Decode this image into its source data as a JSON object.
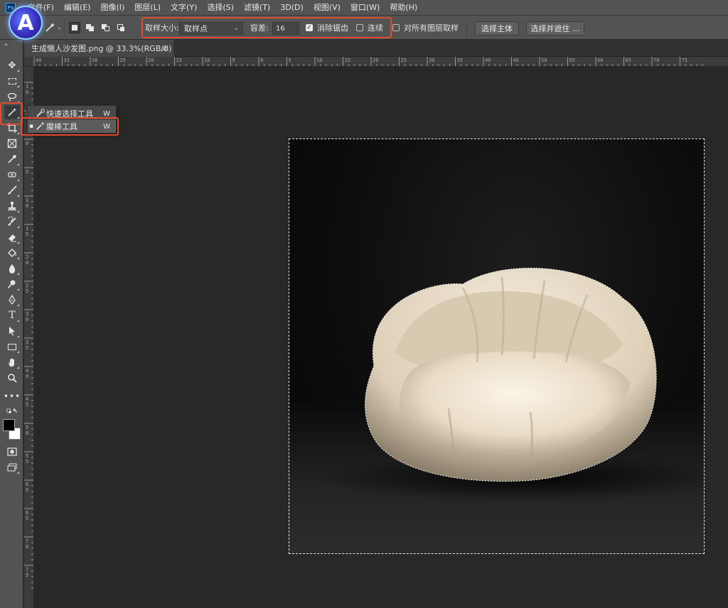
{
  "app": {
    "logo_text": "Ps"
  },
  "badge": {
    "letter": "A"
  },
  "menu": [
    "文件(F)",
    "编辑(E)",
    "图像(I)",
    "图层(L)",
    "文字(Y)",
    "选择(S)",
    "滤镜(T)",
    "3D(D)",
    "视图(V)",
    "窗口(W)",
    "帮助(H)"
  ],
  "options": {
    "tool_caret": "⌄",
    "sample_size_label": "取样大小:",
    "sample_size_value": "取样点",
    "tolerance_label": "容差:",
    "tolerance_value": "16",
    "antialias_label": "消除锯齿",
    "antialias_checked": true,
    "contiguous_label": "连续",
    "contiguous_checked": false,
    "all_layers_label": "对所有图层取样",
    "all_layers_checked": false,
    "select_subject_label": "选择主体",
    "select_mask_label": "选择并遮住 ..."
  },
  "document": {
    "tab_title": "生成懒人沙发图.png @ 33.3%(RGB/8)",
    "close_symbol": "×"
  },
  "ruler": {
    "top_labels": [
      "40",
      "35",
      "30",
      "25",
      "20",
      "15",
      "10",
      "5",
      "0",
      "5",
      "10",
      "15",
      "20",
      "25",
      "30",
      "35",
      "40",
      "45",
      "50",
      "55",
      "60",
      "65",
      "70",
      "75"
    ],
    "left_labels": [
      "1 0",
      "5",
      "0",
      "5",
      "1 0",
      "1 5",
      "2 0",
      "2 5",
      "3 0",
      "3 5",
      "4 0",
      "4 5",
      "5 0",
      "5 5",
      "6 0",
      "6 5",
      "7 0",
      "7 5"
    ]
  },
  "flyout": {
    "items": [
      {
        "label": "快速选择工具",
        "key": "W",
        "selected": false
      },
      {
        "label": "魔棒工具",
        "key": "W",
        "selected": true
      }
    ]
  },
  "colors": {
    "accent_highlight": "#e34a2e",
    "chair": "#efe6d6",
    "background": "#0a0a0a"
  }
}
